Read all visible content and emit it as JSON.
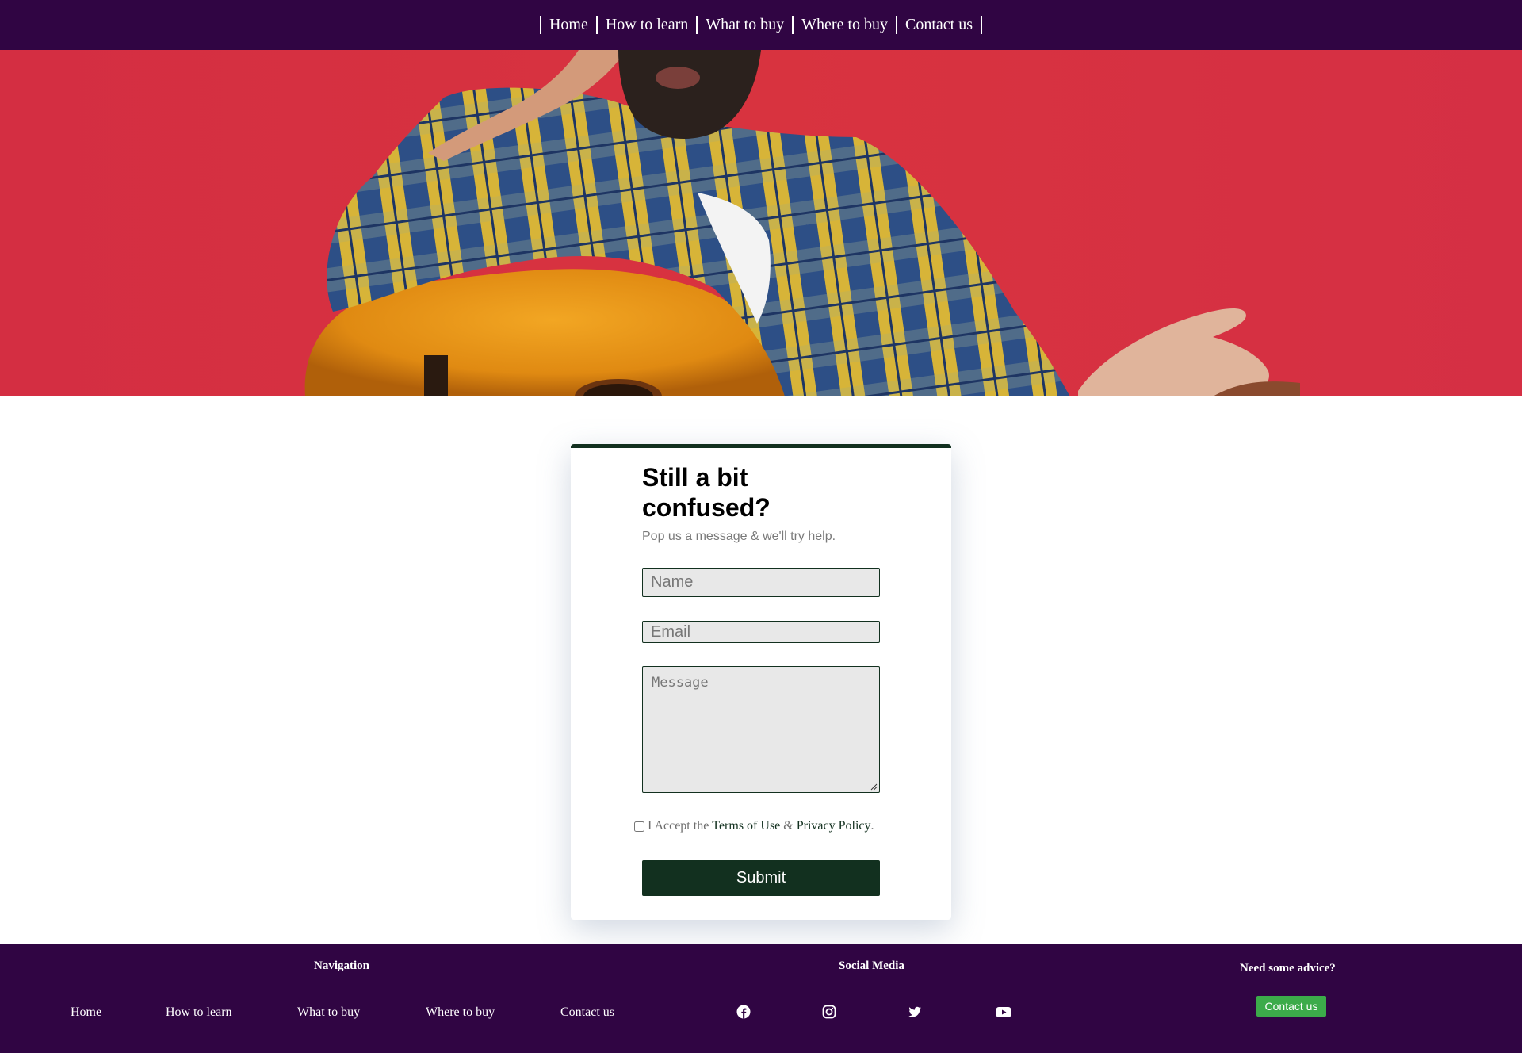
{
  "header_nav": {
    "items": [
      {
        "label": "Home"
      },
      {
        "label": "How to learn"
      },
      {
        "label": "What to buy"
      },
      {
        "label": "Where to buy"
      },
      {
        "label": "Contact us"
      }
    ]
  },
  "hero": {
    "image_subject": "man in plaid shirt with acoustic guitar on red background"
  },
  "contact_form": {
    "title": "Still a bit confused?",
    "subtitle": "Pop us a message & we'll try help.",
    "name_placeholder": "Name",
    "email_placeholder": "Email",
    "message_placeholder": "Message",
    "accept_prefix": "I Accept the",
    "terms_link": "Terms of Use",
    "ampersand": "&",
    "privacy_link": "Privacy Policy",
    "period": ".",
    "submit_label": "Submit"
  },
  "footer": {
    "navigation_heading": "Navigation",
    "navigation_items": [
      "Home",
      "How to learn",
      "What to buy",
      "Where to buy",
      "Contact us"
    ],
    "social_heading": "Social Media",
    "social_icons": [
      "facebook-icon",
      "instagram-icon",
      "twitter-icon",
      "youtube-icon"
    ],
    "advice_heading": "Need some advice?",
    "advice_button": "Contact us"
  },
  "colors": {
    "nav_background": "#300543",
    "hero_background": "#d42e42",
    "accent_dark_green": "#12301f",
    "cta_green": "#3cab4a"
  }
}
